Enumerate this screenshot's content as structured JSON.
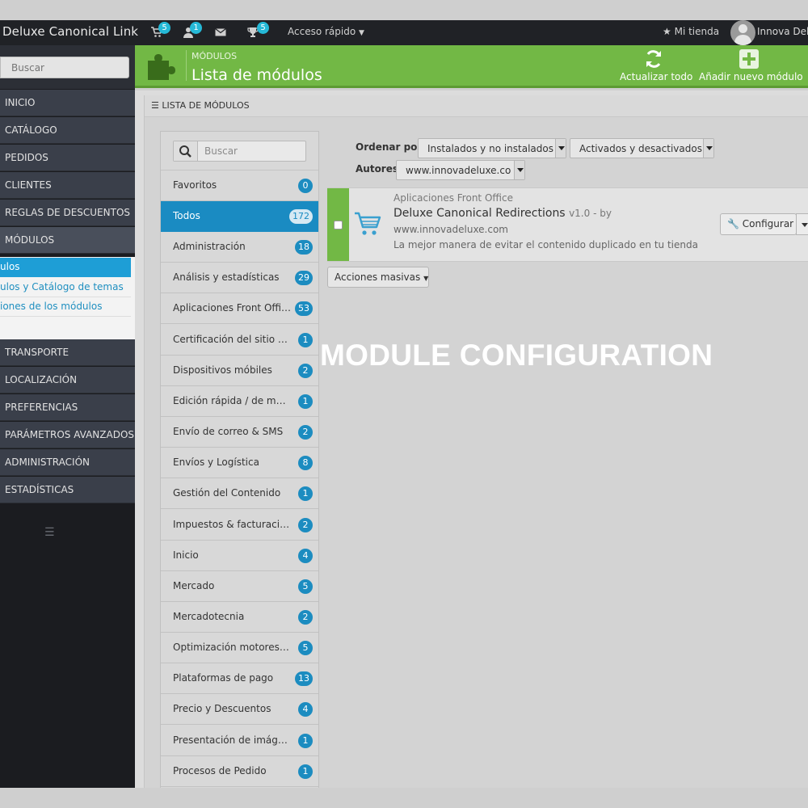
{
  "topbar": {
    "brand": "Deluxe Canonical Link",
    "badges": {
      "orders": "5",
      "customers": "1",
      "trophies": "5"
    },
    "quick_access": "Acceso rápido",
    "store": "Mi tienda",
    "user": "Innova Deluxe"
  },
  "sidebar": {
    "search_placeholder": "Buscar",
    "items": [
      "INICIO",
      "CATÁLOGO",
      "PEDIDOS",
      "CLIENTES",
      "REGLAS DE DESCUENTOS",
      "MÓDULOS",
      "TRANSPORTE",
      "LOCALIZACIÓN",
      "PREFERENCIAS",
      "PARÁMETROS AVANZADOS",
      "ADMINISTRACIÓN",
      "ESTADÍSTICAS"
    ],
    "submenu": [
      "ulos",
      "ulos y Catálogo de temas",
      "iones de los módulos"
    ]
  },
  "header": {
    "breadcrumb": "MÓDULOS",
    "title": "Lista de módulos",
    "refresh_label": "Actualizar todo",
    "add_label": "Añadir nuevo módulo"
  },
  "panel": {
    "heading": "LISTA DE MÓDULOS"
  },
  "categories": {
    "search_placeholder": "Buscar",
    "items": [
      {
        "label": "Favoritos",
        "count": "0"
      },
      {
        "label": "Todos",
        "count": "172"
      },
      {
        "label": "Administración",
        "count": "18"
      },
      {
        "label": "Análisis y estadísticas",
        "count": "29"
      },
      {
        "label": "Aplicaciones Front Office",
        "count": "53"
      },
      {
        "label": "Certificación del sitio & ...",
        "count": "1"
      },
      {
        "label": "Dispositivos móbiles",
        "count": "2"
      },
      {
        "label": "Edición rápida / de masa",
        "count": "1"
      },
      {
        "label": "Envío de correo & SMS",
        "count": "2"
      },
      {
        "label": "Envíos y Logística",
        "count": "8"
      },
      {
        "label": "Gestión del Contenido",
        "count": "1"
      },
      {
        "label": "Impuestos & facturación",
        "count": "2"
      },
      {
        "label": "Inicio",
        "count": "4"
      },
      {
        "label": "Mercado",
        "count": "5"
      },
      {
        "label": "Mercadotecnia",
        "count": "2"
      },
      {
        "label": "Optimización motores d...",
        "count": "5"
      },
      {
        "label": "Plataformas de pago",
        "count": "13"
      },
      {
        "label": "Precio y Descuentos",
        "count": "4"
      },
      {
        "label": "Presentación de imágen...",
        "count": "1"
      },
      {
        "label": "Procesos de Pedido",
        "count": "1"
      }
    ]
  },
  "filters": {
    "sort_label": "Ordenar por",
    "sort_value": "Instalados y no instalados",
    "status_value": "Activados y desactivados",
    "authors_label": "Autores",
    "authors_value": "www.innovadeluxe.co"
  },
  "module": {
    "category": "Aplicaciones Front Office",
    "name": "Deluxe Canonical Redirections",
    "version": "v1.0 - by",
    "author": "www.innovadeluxe.com",
    "description": "La mejor manera de evitar el contenido duplicado en tu tienda",
    "configure_label": "Configurar"
  },
  "bulk_actions": "Acciones masivas",
  "overlay_title": "MODULE CONFIGURATION",
  "colors": {
    "accent_green": "#72b845",
    "accent_blue": "#1a8bc2",
    "badge_blue": "#25b9d7"
  }
}
